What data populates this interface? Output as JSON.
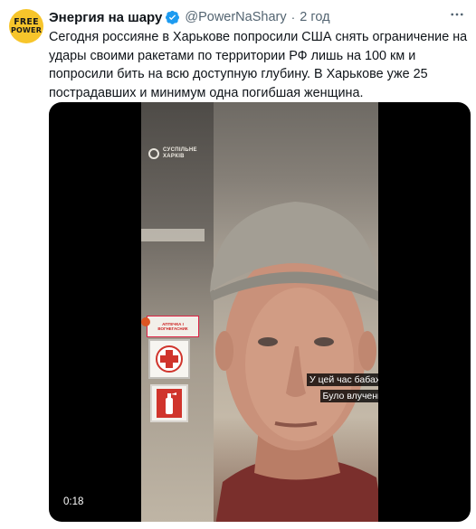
{
  "author": {
    "avatar_line1": "FREE",
    "avatar_line2": "POWER",
    "name": "Энергия на шару",
    "handle": "@PowerNaShary",
    "separator": "·",
    "time": "2 год"
  },
  "tweet": {
    "text": "Сегодня россияне в Харькове попросили США снять ограничение на удары своими ракетами по территории РФ лишь на 100 км и попросили бить на всю доступную глубину. В Харькове уже 25 пострадавших и минимум одна погибшая женщина."
  },
  "video": {
    "watermark_line1": "СУСПІЛЬНЕ",
    "watermark_line2": "ХАРКІВ",
    "sign_text": "АПТЕЧКА І ВОГНЕГАСНИК",
    "subtitle_line1": "У цей час бабахнуло.",
    "subtitle_line2": "Було влучення.",
    "duration": "0:18"
  },
  "colors": {
    "verified_badge": "#1d9bf0",
    "avatar_bg": "#f7c52b",
    "text_primary": "#0f1419",
    "text_secondary": "#536471"
  },
  "icons": {
    "verified": "verified-badge-icon",
    "more": "more-icon",
    "red_cross": "red-cross-icon",
    "extinguisher": "fire-extinguisher-icon"
  }
}
